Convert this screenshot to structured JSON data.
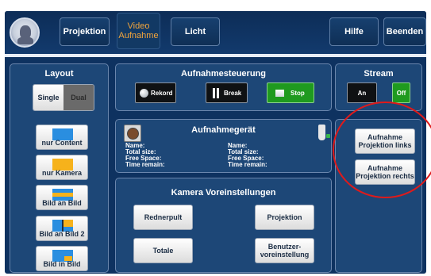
{
  "nav": {
    "projektion": "Projektion",
    "video_line1": "Video",
    "video_line2": "Aufnahme",
    "licht": "Licht",
    "hilfe": "Hilfe",
    "beenden": "Beenden"
  },
  "layout_panel": {
    "title": "Layout",
    "single": "Single",
    "dual": "Dual",
    "items": [
      {
        "label": "nur Content"
      },
      {
        "label": "nur Kamera"
      },
      {
        "label": "Bild an Bild"
      },
      {
        "label": "Bild an Bild 2"
      },
      {
        "label": "Bild in Bild"
      }
    ]
  },
  "recording": {
    "title": "Aufnahmesteuerung",
    "rekord": "Rekord",
    "break": "Break",
    "stop": "Stop"
  },
  "stream": {
    "title": "Stream",
    "an": "An",
    "off": "Off"
  },
  "device": {
    "title": "Aufnahmegerät",
    "left": [
      "Name:",
      "Total size:",
      "Free Space:",
      "Time remain:"
    ],
    "right": [
      "Name:",
      "Total size:",
      "Free Space:",
      "Time remain:"
    ]
  },
  "camera": {
    "title": "Kamera Voreinstellungen",
    "rednerpult": "Rednerpult",
    "projektion": "Projektion",
    "totale": "Totale",
    "benutzer_line1": "Benutzer-",
    "benutzer_line2": "voreinstellung"
  },
  "aufnahme": {
    "links_line1": "Aufnahme",
    "links_line2": "Projektion links",
    "rechts_line1": "Aufnahme",
    "rechts_line2": "Projektion rechts"
  },
  "colors": {
    "background": "#0e3260",
    "panel": "#1d4777",
    "active_tab": "#f3a53b",
    "green": "#1f9a1f",
    "blue_tile": "#2a8ee0",
    "yellow_tile": "#f6b21b",
    "annotation": "#e01a1a"
  }
}
